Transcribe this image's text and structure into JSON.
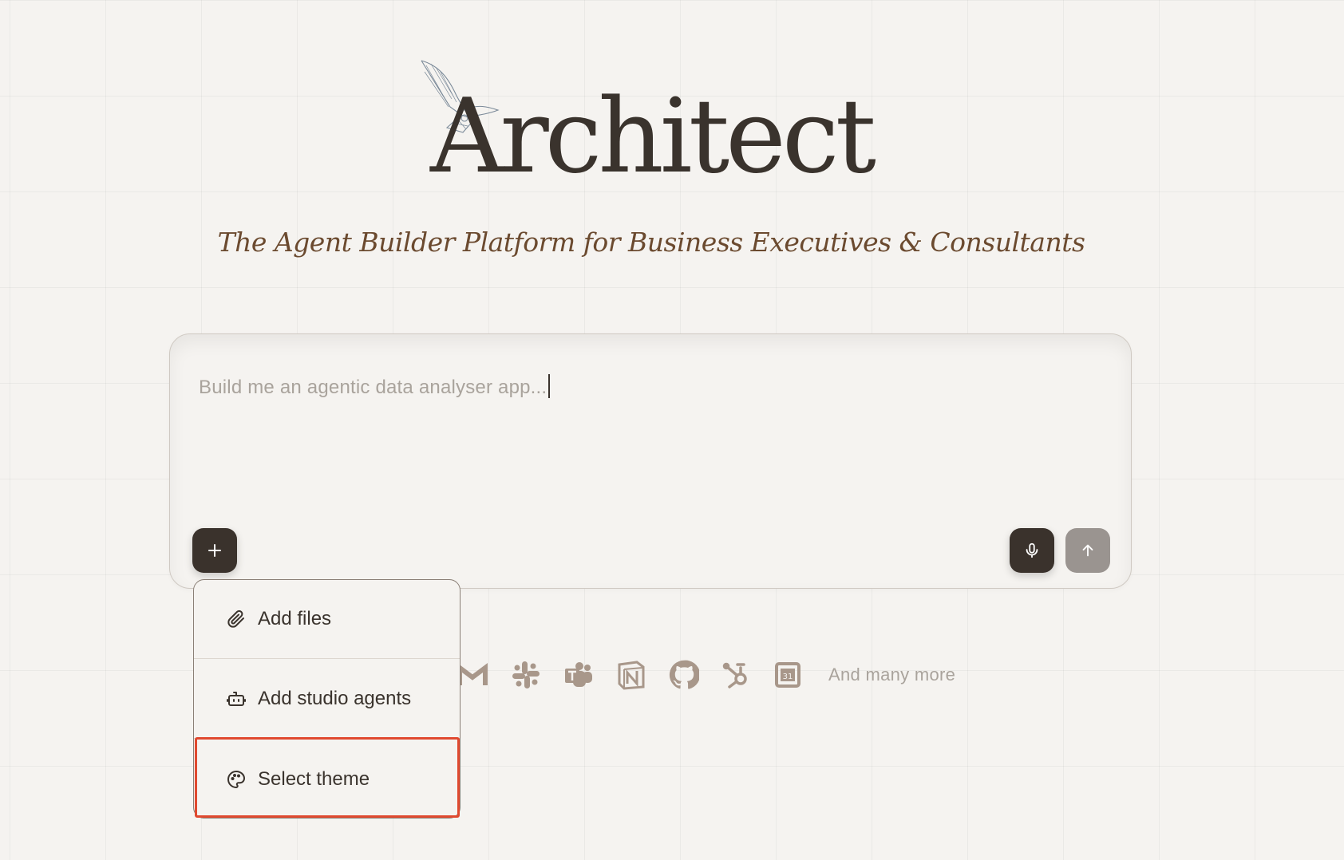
{
  "hero": {
    "title": "Architect",
    "subtitle": "The Agent Builder Platform for Business Executives & Consultants",
    "logo_icon": "ornithopter-sketch-icon"
  },
  "composer": {
    "placeholder": "Build me an agentic data analyser app...",
    "add_button_icon": "plus-icon",
    "mic_button_icon": "microphone-icon",
    "send_button_icon": "arrow-up-icon"
  },
  "integrations": {
    "icons": [
      "gmail-icon",
      "slack-icon",
      "teams-icon",
      "notion-icon",
      "github-icon",
      "hubspot-icon",
      "google-calendar-icon"
    ],
    "more_label": "And many more"
  },
  "menu": {
    "items": [
      {
        "label": "Add files",
        "icon": "paperclip-icon"
      },
      {
        "label": "Add studio agents",
        "icon": "robot-icon"
      },
      {
        "label": "Select theme",
        "icon": "palette-icon",
        "highlighted": true
      }
    ]
  },
  "colors": {
    "background": "#f5f3f0",
    "title": "#3a332d",
    "subtitle": "#6b4a2f",
    "dark_button": "#3a322c",
    "send_button": "#9a9490",
    "integration_icon": "#a8978a",
    "highlight": "#e0492f"
  }
}
